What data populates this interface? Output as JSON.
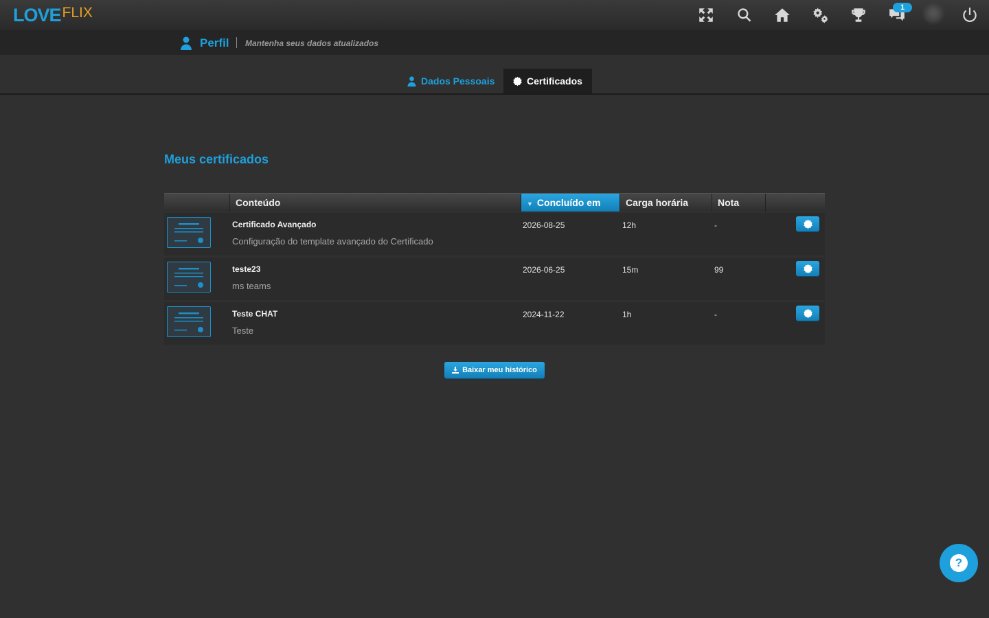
{
  "app": {
    "logo_primary": "LOVE",
    "logo_secondary": "FLIX",
    "notification_count": "1",
    "top_icons": [
      "fullscreen-icon",
      "search-icon",
      "home-icon",
      "settings-icon",
      "trophy-icon",
      "chat-icon",
      "avatar",
      "power-icon"
    ]
  },
  "profile": {
    "title": "Perfil",
    "subtitle": "Mantenha seus dados atualizados"
  },
  "tabs": [
    {
      "label": "Dados Pessoais",
      "icon": "user-icon",
      "active": false
    },
    {
      "label": "Certificados",
      "icon": "badge-icon",
      "active": true
    }
  ],
  "section": {
    "title": "Meus certificados"
  },
  "table": {
    "columns": [
      "",
      "Conteúdo",
      "Concluído em",
      "Carga horária",
      "Nota",
      ""
    ],
    "sorted_column": "Concluído em",
    "rows": [
      {
        "title": "Certificado Avançado",
        "description": "Configuração do template avançado do Certificado",
        "completed": "2026-08-25",
        "load": "12h",
        "grade": "-"
      },
      {
        "title": "teste23",
        "description": "ms teams",
        "completed": "2026-06-25",
        "load": "15m",
        "grade": "99"
      },
      {
        "title": "Teste CHAT",
        "description": "Teste",
        "completed": "2024-11-22",
        "load": "1h",
        "grade": "-"
      }
    ]
  },
  "actions": {
    "download_history": "Baixar meu histórico",
    "help": "?"
  },
  "colors": {
    "accent": "#1ea0dc",
    "logo_secondary": "#e8a020",
    "background": "#303030"
  }
}
